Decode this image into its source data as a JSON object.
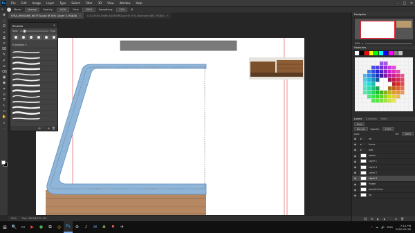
{
  "menubar": {
    "logo": "Ps",
    "items": [
      "File",
      "Edit",
      "Image",
      "Layer",
      "Type",
      "Select",
      "Filter",
      "3D",
      "View",
      "Window",
      "Help"
    ],
    "window_controls": [
      "–",
      "□",
      "✕"
    ]
  },
  "options": {
    "mode_label": "Mode:",
    "mode_value": "Normal",
    "opacity_label": "Opacity:",
    "opacity_value": "100%",
    "flow_label": "Flow:",
    "flow_value": "100%",
    "smoothing_label": "Smoothing:",
    "smoothing_value": "10%"
  },
  "tabs": [
    {
      "label": "KTRA_WINGAME_WETTEA.psd @ 50% (Layer 3, RGB/8)",
      "active": true
    },
    {
      "label": "LOCATION_SHIMI_BACKYARD.psd @ 50% (Backyard BAY, RGB/8)",
      "active": false
    }
  ],
  "tools": [
    "✥",
    "⬚",
    "ʘ",
    "⌖",
    "⧉",
    "✂",
    "⌧",
    "✎",
    "✐",
    "⛀",
    "⌫",
    "▣",
    "◉",
    "✦",
    "⊙",
    "T",
    "↖",
    "▭",
    "✋",
    "⌕",
    "…"
  ],
  "brushes_panel": {
    "title": "Brushes",
    "size_label": "Size:",
    "size_value": "9 px",
    "preset_sizes": [
      "30",
      "25",
      "25",
      "25",
      "50",
      "25"
    ],
    "group_label": "▾ Amateur 2",
    "footer_icons": [
      "⊞",
      "🗀",
      "⊕",
      "🗑"
    ]
  },
  "status": {
    "zoom": "50%",
    "doc": "Doc: 36.0M/275.1M"
  },
  "navigator": {
    "title": "Navigator",
    "zoom": "50%"
  },
  "swatches": {
    "title": "Swatches",
    "colors": [
      "#ffffff",
      "#000000",
      "#ff0000",
      "#ffff00",
      "#00ff00",
      "#00ffff",
      "#0000ff",
      "#ff00ff",
      "#7f7f7f",
      "#c0c0c0"
    ]
  },
  "layers": {
    "tabs": [
      "Layers",
      "Channels",
      "Paths"
    ],
    "kind_label": "Kind",
    "blend_value": "Normal",
    "opacity_label": "Opacity:",
    "opacity_value": "100%",
    "lock_label": "Lock:",
    "fill_label": "Fill:",
    "fill_value": "100%",
    "rows": [
      {
        "name": "ref",
        "type": "folder",
        "active": false
      },
      {
        "name": "frame",
        "type": "folder",
        "active": false
      },
      {
        "name": "wall",
        "type": "folder",
        "active": false
      },
      {
        "name": "sketch",
        "type": "layer",
        "active": false
      },
      {
        "name": "Layer 1",
        "type": "layer",
        "active": false
      },
      {
        "name": "Layer 4",
        "type": "layer",
        "active": false
      },
      {
        "name": "Layer 2",
        "type": "layer",
        "active": false
      },
      {
        "name": "Layer 3",
        "type": "layer",
        "active": true
      },
      {
        "name": "Platter",
        "type": "layer",
        "active": false
      },
      {
        "name": "base/int blue",
        "type": "layer",
        "active": false
      },
      {
        "name": "bg",
        "type": "layer",
        "active": false
      }
    ],
    "footer_icons": [
      "⛓",
      "fx",
      "◐",
      "◑",
      "🗀",
      "⊕",
      "🗑"
    ]
  },
  "taskbar": {
    "start": "⊞",
    "icons": [
      "🔍",
      "▭",
      "▶",
      "●",
      "⧉",
      "◎",
      "Ps",
      "⚙",
      "♪",
      "✉",
      "♣",
      "⚑",
      "✈"
    ],
    "tray_icons": [
      "^",
      "☁",
      "🔊",
      "ENG"
    ],
    "time": "7:15 PM",
    "date": "2020-05-28"
  }
}
